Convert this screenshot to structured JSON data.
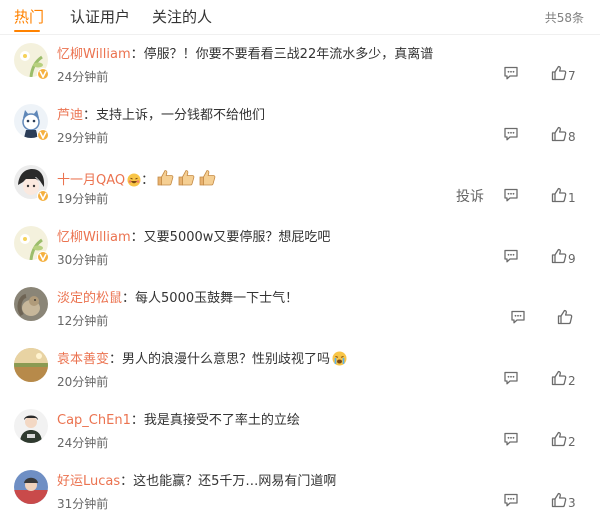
{
  "tabs": [
    {
      "label": "热门",
      "active": true
    },
    {
      "label": "认证用户",
      "active": false
    },
    {
      "label": "关注的人",
      "active": false
    }
  ],
  "total_label": "共58条",
  "colors": {
    "accent": "#ff8200",
    "username": "#eb7350",
    "badge": "#f5b03e"
  },
  "comments": [
    {
      "user": "忆柳William",
      "sep": "：",
      "text": "停服？！你要不要看看三战22年流水多少，真离谱",
      "time": "24分钟前",
      "likes": "7",
      "verified": true,
      "avatar_icon": "flower-avatar-icon"
    },
    {
      "user": "芦迪",
      "sep": "：",
      "text": "支持上诉，一分钱都不给他们",
      "time": "29分钟前",
      "likes": "8",
      "verified": true,
      "avatar_icon": "cat-avatar-icon"
    },
    {
      "user": "十一月QAQ",
      "sep": "：",
      "text": "",
      "time": "19分钟前",
      "likes": "1",
      "verified": true,
      "avatar_icon": "anime-avatar-icon",
      "report_label": "投诉",
      "emojis": [
        "laugh-cry-emoji-icon",
        "thumbs-up-emoji-icon",
        "thumbs-up-emoji-icon",
        "thumbs-up-emoji-icon"
      ]
    },
    {
      "user": "忆柳William",
      "sep": "：",
      "text": "又要5000w又要停服？想屁吃吧",
      "time": "30分钟前",
      "likes": "9",
      "verified": true,
      "avatar_icon": "flower-avatar-icon"
    },
    {
      "user": "淡定的松鼠",
      "sep": "：",
      "text": "每人5000玉鼓舞一下士气！",
      "time": "12分钟前",
      "likes": "",
      "verified": false,
      "avatar_icon": "squirrel-avatar-icon"
    },
    {
      "user": "袁本善变",
      "sep": "：",
      "text": "男人的浪漫什么意思？性别歧视了吗",
      "time": "20分钟前",
      "likes": "2",
      "verified": false,
      "avatar_icon": "landscape-avatar-icon",
      "emojis": [
        "crying-emoji-icon"
      ]
    },
    {
      "user": "Cap_ChEn1",
      "sep": "：",
      "text": "我是真接受不了率土的立绘",
      "time": "24分钟前",
      "likes": "2",
      "verified": false,
      "avatar_icon": "person-avatar-icon"
    },
    {
      "user": "好运Lucas",
      "sep": "：",
      "text": "这也能赢？还5千万…网易有门道啊",
      "time": "31分钟前",
      "likes": "3",
      "verified": false,
      "avatar_icon": "photo-avatar-icon"
    }
  ]
}
